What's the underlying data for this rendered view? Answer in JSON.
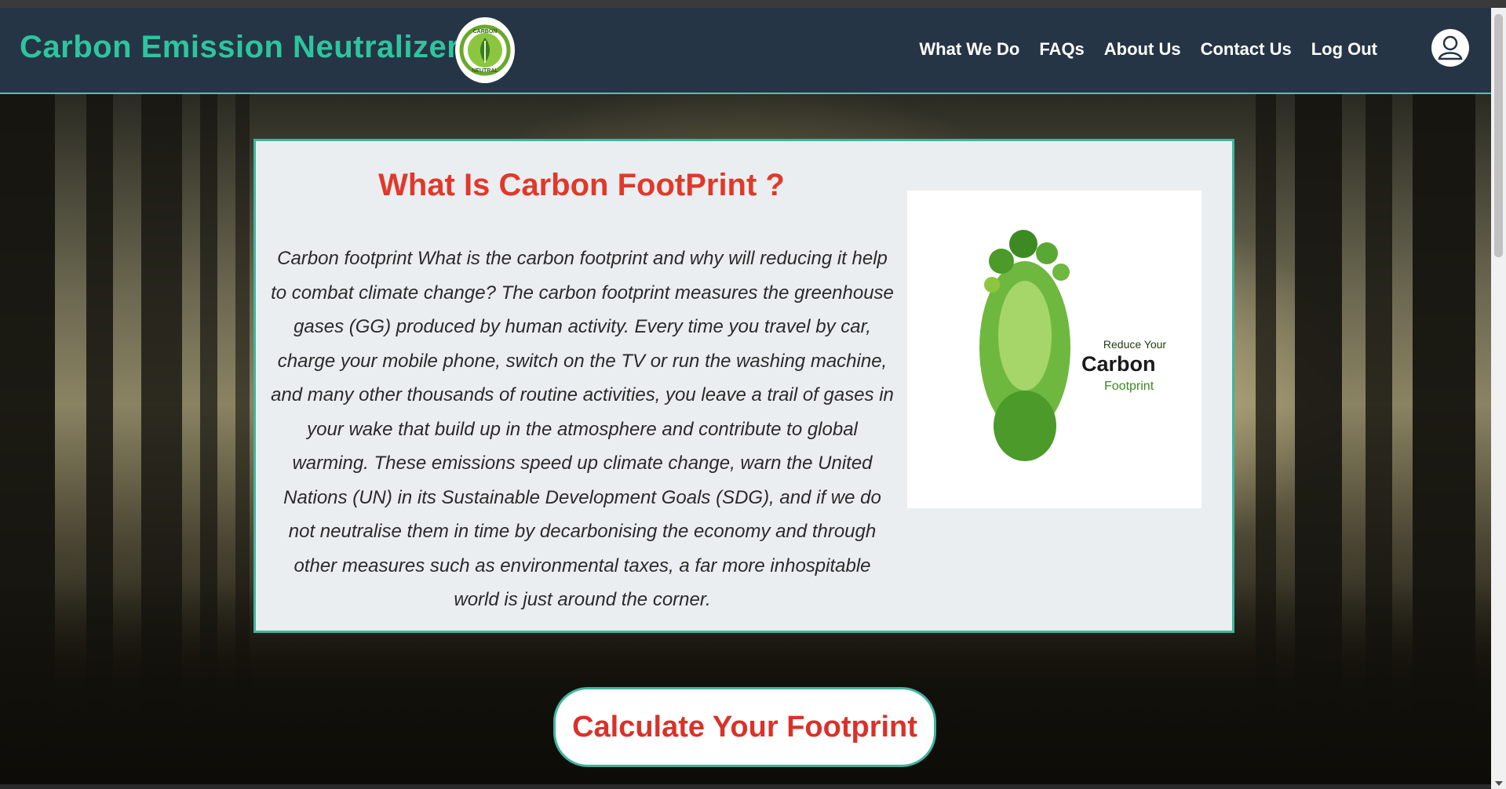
{
  "header": {
    "brand": "Carbon Emission Neutralizer",
    "logo_text_top": "CARBON",
    "logo_text_bottom": "NEUTRAL",
    "nav": [
      "What We Do",
      "FAQs",
      "About Us",
      "Contact Us",
      "Log Out"
    ]
  },
  "card": {
    "title": "What Is Carbon FootPrint ?",
    "body": "Carbon footprint What is the carbon footprint and why will reducing it help to combat climate change? The carbon footprint measures the greenhouse gases (GG) produced by human activity. Every time you travel by car, charge your mobile phone, switch on the TV or run the washing machine, and many other thousands of routine activities, you leave a trail of gases in your wake that build up in the atmosphere and contribute to global warming. These emissions speed up climate change, warn the United Nations (UN) in its Sustainable Development Goals (SDG), and if we do not neutralise them in time by decarbonising the economy and through other measures such as environmental taxes, a far more inhospitable world is just around the corner.",
    "image": {
      "line1": "Reduce Your",
      "line2": "Carbon",
      "line3": "Footprint"
    }
  },
  "cta": {
    "label": "Calculate Your Footprint"
  },
  "colors": {
    "navbar": "#263545",
    "brand": "#2ec4a0",
    "accent_border": "#3fb5a0",
    "title_red": "#e0392b",
    "cta_red": "#d8322a"
  },
  "icons": {
    "user": "user-icon",
    "logo": "leaf-logo-icon",
    "footprint": "footprint-icon"
  }
}
